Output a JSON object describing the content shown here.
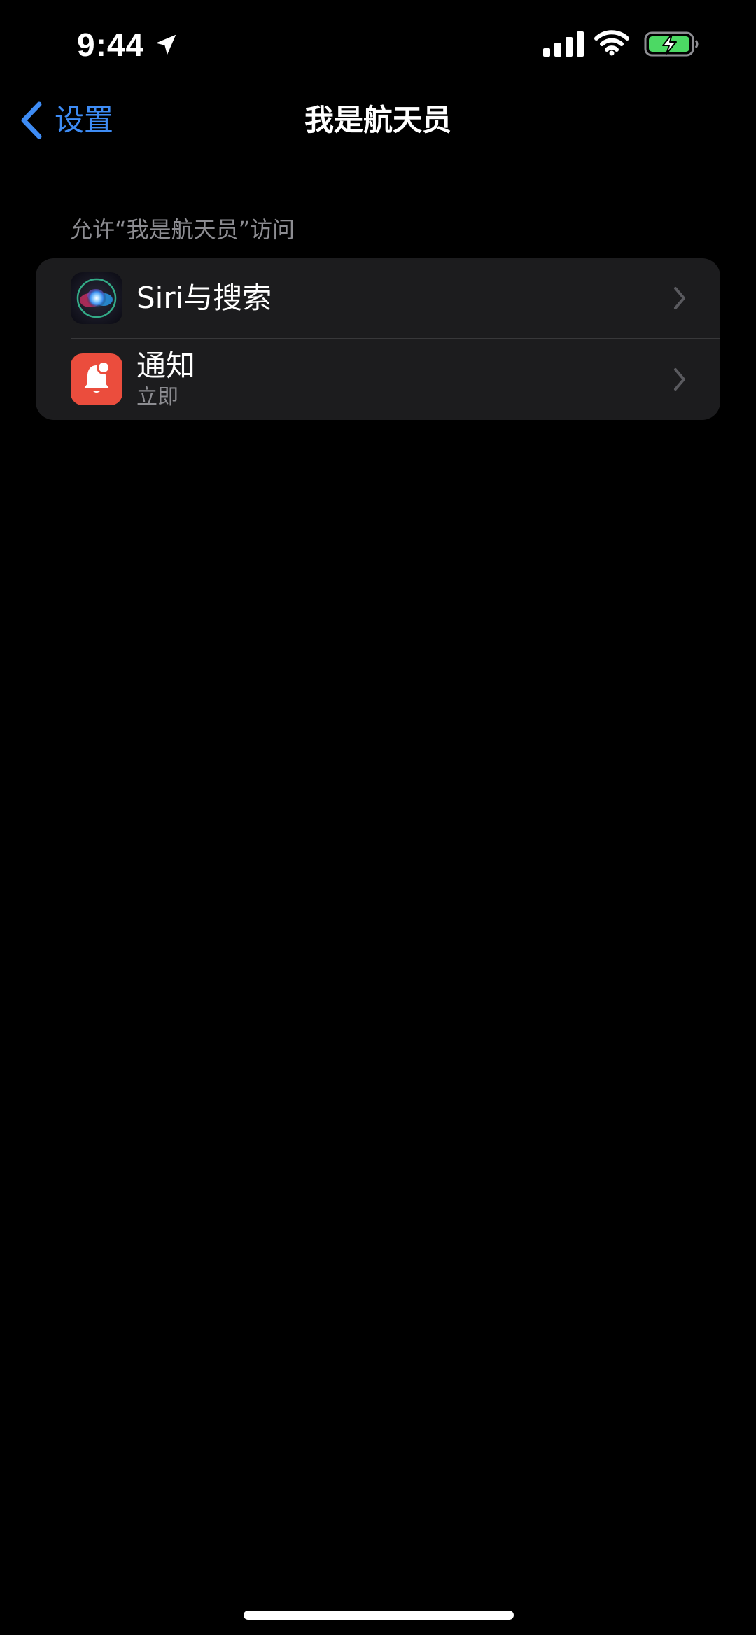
{
  "status_bar": {
    "time": "9:44",
    "icons": [
      "location-arrow-icon",
      "cellular-signal-icon",
      "wifi-icon",
      "battery-charging-icon"
    ],
    "battery_color": "#4cd964"
  },
  "nav": {
    "back_label": "设置",
    "title": "我是航天员"
  },
  "section": {
    "header": "允许“我是航天员”访问",
    "rows": [
      {
        "title": "Siri与搜索",
        "subtitle": "",
        "icon": "siri-icon"
      },
      {
        "title": "通知",
        "subtitle": "立即",
        "icon": "notifications-icon",
        "icon_color": "#eb4d3d"
      }
    ]
  },
  "colors": {
    "background": "#000000",
    "group_background": "#1c1c1e",
    "accent": "#3e8cf5",
    "secondary_text": "#8d8d92"
  }
}
